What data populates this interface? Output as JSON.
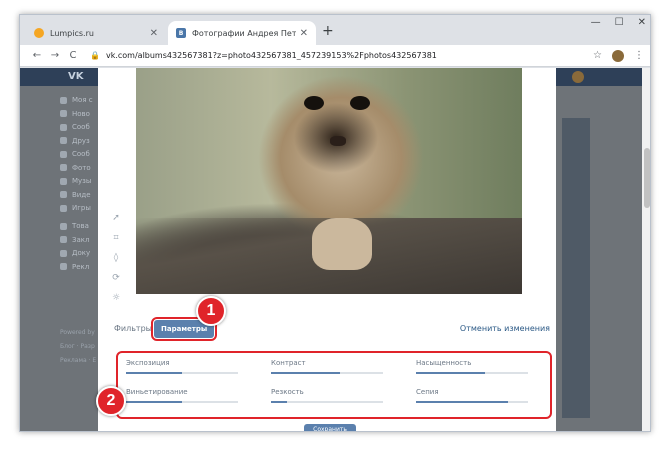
{
  "browser": {
    "tabs": [
      {
        "title": "Lumpics.ru",
        "close": "✕"
      },
      {
        "title": "Фотографии Андрея Петрова –",
        "close": "✕"
      }
    ],
    "new_tab": "+",
    "window_controls": {
      "minimize": "—",
      "maximize": "☐",
      "close": "✕"
    },
    "url": "vk.com/albums432567381?z=photo432567381_457239153%2Fphotos432567381",
    "back": "←",
    "forward": "→",
    "reload": "C",
    "lock": "🔒",
    "star": "☆",
    "menu": "⋮"
  },
  "vk": {
    "logo": "VK",
    "menu_items": [
      "Моя с",
      "Ново",
      "Сооб",
      "Друз",
      "Сооб",
      "Фото",
      "Музы",
      "Виде",
      "Игры",
      "Това",
      "Закл",
      "Доку",
      "Рекл"
    ],
    "footer": [
      "Powered by",
      "Блог · Разр",
      "Реклама · Е"
    ]
  },
  "editor": {
    "tabs": {
      "filters": "Фильтры",
      "params": "Параметры"
    },
    "reset": "Отменить изменения",
    "params": [
      {
        "label": "Экспозиция",
        "value": 0.5
      },
      {
        "label": "Контраст",
        "value": 0.62
      },
      {
        "label": "Насыщенность",
        "value": 0.62
      },
      {
        "label": "Виньетирование",
        "value": 0.5
      },
      {
        "label": "Резкость",
        "value": 0.14
      },
      {
        "label": "Сепия",
        "value": 0.82
      }
    ],
    "save": "Сохранить"
  },
  "annotations": {
    "badge1": "1",
    "badge2": "2"
  },
  "colors": {
    "accent": "#5b80ad",
    "highlight": "#e0242a",
    "vk_header": "#2e4058"
  }
}
